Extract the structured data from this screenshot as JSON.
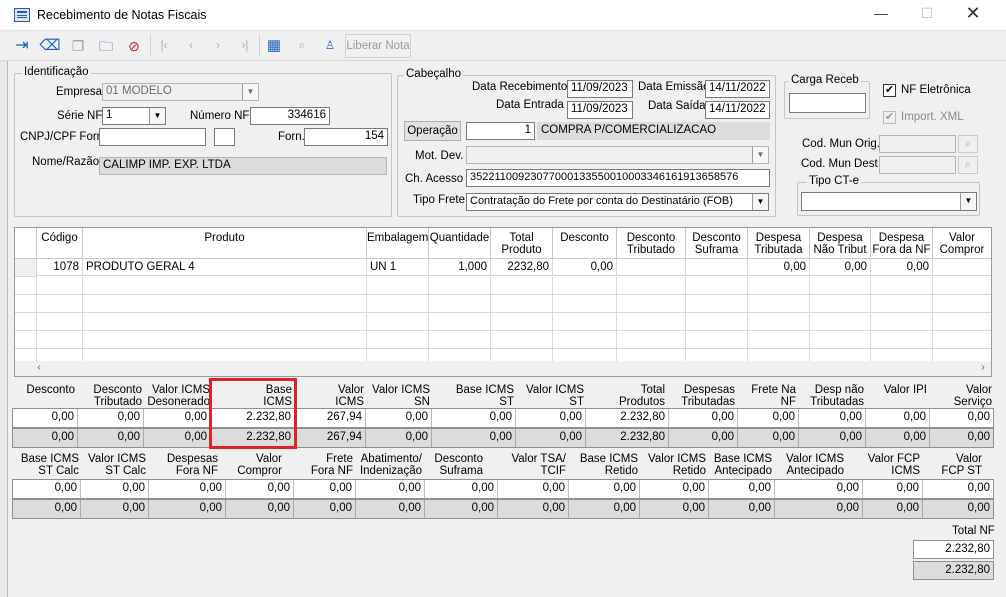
{
  "window": {
    "title": "Recebimento de Notas Fiscais"
  },
  "toolbar": {
    "liberar_label": "Liberar Nota"
  },
  "identificacao": {
    "title": "Identificação",
    "empresa_label": "Empresa",
    "empresa_value": "01 MODELO",
    "serie_label": "Série NF",
    "serie_value": "1",
    "numero_label": "Número NF",
    "numero_value": "334616",
    "cnpj_label": "CNPJ/CPF Forn.",
    "forn_label": "Forn.",
    "forn_value": "154",
    "nome_label": "Nome/Razão",
    "nome_value": "CALIMP IMP. EXP. LTDA"
  },
  "cabecalho": {
    "title": "Cabeçalho",
    "data_receb_label": "Data Recebimento",
    "data_receb_value": "11/09/2023",
    "data_emissao_label": "Data Emissão",
    "data_emissao_value": "14/11/2022",
    "data_entrada_label": "Data Entrada",
    "data_entrada_value": "11/09/2023",
    "data_saida_label": "Data Saída",
    "data_saida_value": "14/11/2022",
    "operacao_label": "Operação",
    "operacao_code": "1",
    "operacao_desc": "COMPRA P/COMERCIALIZACAO",
    "mot_dev_label": "Mot. Dev.",
    "ch_acesso_label": "Ch. Acesso",
    "ch_acesso_value": "35221100923077000133550010003346161913658576",
    "tipo_frete_label": "Tipo Frete",
    "tipo_frete_value": "Contratação do Frete por conta do Destinatário (FOB)"
  },
  "right_panel": {
    "carga_label": "Carga Receb",
    "nf_eletronica_label": "NF Eletrônica",
    "import_xml_label": "Import. XML",
    "cod_mun_orig_label": "Cod. Mun Orig.",
    "cod_mun_dest_label": "Cod. Mun Dest.",
    "tipo_cte_label": "Tipo CT-e"
  },
  "items_grid": {
    "headers": [
      "Código",
      "Produto",
      "Embalagem",
      "Quantidade",
      "Total Produto",
      "Desconto",
      "Desconto Tributado",
      "Desconto Suframa",
      "Despesa Tributada",
      "Despesa Não Tribut",
      "Despesa Fora da NF",
      "Valor Compror"
    ],
    "row": {
      "codigo": "1078",
      "produto": "PRODUTO GERAL 4",
      "embalagem": "UN  1",
      "quantidade": "1,000",
      "total": "2232,80",
      "desconto": "0,00",
      "desp_trib": "0,00",
      "desp_nao": "0,00",
      "desp_fora": "0,00"
    }
  },
  "totals1": {
    "headers": [
      "Desconto",
      "Desconto Tributado",
      "Valor ICMS Desonerado",
      "Base ICMS",
      "Valor ICMS",
      "Valor ICMS SN",
      "Base ICMS ST",
      "Valor ICMS ST",
      "Total Produtos",
      "Despesas Tributadas",
      "Frete Na NF",
      "Desp não Tributadas",
      "Valor IPI",
      "Valor Serviço"
    ],
    "row1": [
      "0,00",
      "0,00",
      "0,00",
      "2.232,80",
      "267,94",
      "0,00",
      "0,00",
      "0,00",
      "2.232,80",
      "0,00",
      "0,00",
      "0,00",
      "0,00",
      "0,00"
    ],
    "row2": [
      "0,00",
      "0,00",
      "0,00",
      "2.232,80",
      "267,94",
      "0,00",
      "0,00",
      "0,00",
      "2.232,80",
      "0,00",
      "0,00",
      "0,00",
      "0,00",
      "0,00"
    ]
  },
  "totals2": {
    "headers": [
      "Base ICMS ST Calc",
      "Valor ICMS ST Calc",
      "Despesas Fora NF",
      "Valor Compror",
      "Frete Fora NF",
      "Abatimento/ Indenização",
      "Desconto Suframa",
      "Valor TSA/ TCIF",
      "Base ICMS Retido",
      "Valor ICMS Retido",
      "Base ICMS Antecipado",
      "Valor ICMS Antecipado",
      "Valor FCP ICMS",
      "Valor FCP ST"
    ],
    "row1": [
      "0,00",
      "0,00",
      "0,00",
      "0,00",
      "0,00",
      "0,00",
      "0,00",
      "0,00",
      "0,00",
      "0,00",
      "0,00",
      "0,00",
      "0,00",
      "0,00"
    ],
    "row2": [
      "0,00",
      "0,00",
      "0,00",
      "0,00",
      "0,00",
      "0,00",
      "0,00",
      "0,00",
      "0,00",
      "0,00",
      "0,00",
      "0,00",
      "0,00",
      "0,00"
    ]
  },
  "total_nf": {
    "label": "Total NF",
    "value1": "2.232,80",
    "value2": "2.232,80"
  },
  "colors": {
    "highlight": "#e0202a"
  }
}
